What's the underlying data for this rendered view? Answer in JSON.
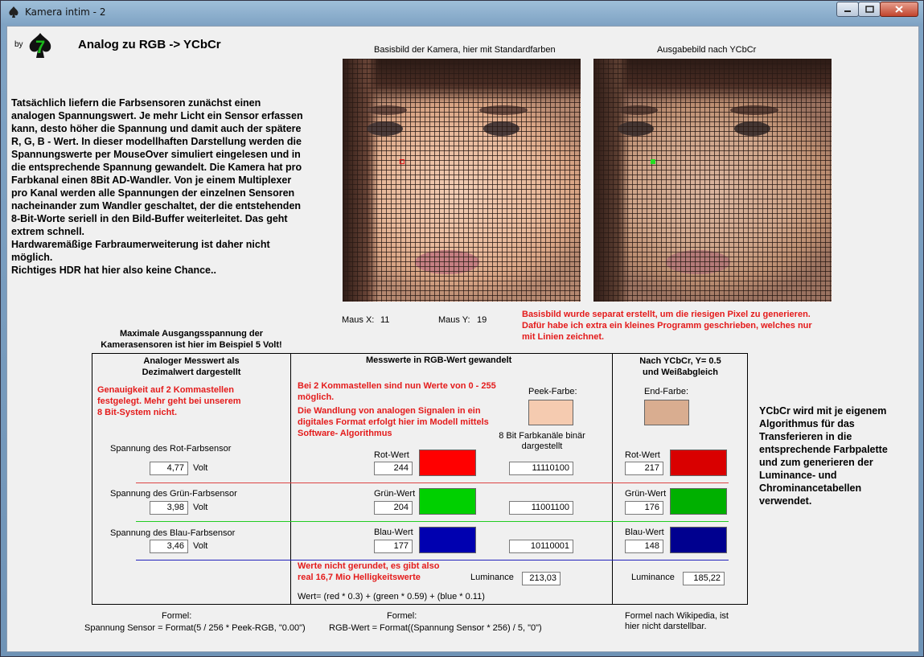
{
  "window": {
    "title": "Kamera intim - 2"
  },
  "header": {
    "by_label": "by",
    "title": "Analog zu RGB -> YCbCr"
  },
  "intro_lines": [
    "Tatsächlich liefern die Farbsensoren zunächst einen",
    "analogen Spannungswert. Je mehr Licht ein Sensor erfassen",
    "kann, desto höher die Spannung und damit auch der spätere",
    "R, G, B - Wert. In dieser modellhaften Darstellung werden die",
    "Spannungswerte per MouseOver simuliert eingelesen und in",
    "die entsprechende Spannung gewandelt. Die Kamera hat pro",
    "Farbkanal einen 8Bit AD-Wandler. Von je einem Multiplexer",
    "pro Kanal werden alle Spannungen der einzelnen Sensoren",
    "nacheinander zum Wandler geschaltet, der die entstehenden",
    "8-Bit-Worte seriell in den Bild-Buffer weiterleitet. Das geht",
    "extrem schnell.",
    "Hardwaremäßige Farbraumerweiterung ist daher nicht",
    "möglich.",
    "Richtiges HDR hat hier also keine Chance.."
  ],
  "images": {
    "left_caption": "Basisbild der Kamera, hier mit Standardfarben",
    "right_caption": "Ausgabebild nach YCbCr",
    "cursor_left_color": "#e41b1b",
    "cursor_right_color": "#22dd22"
  },
  "mouse": {
    "x_label": "Maus X:",
    "x_value": "11",
    "y_label": "Maus Y:",
    "y_value": "19"
  },
  "note_pixels": [
    "Basisbild wurde separat erstellt, um die riesigen Pixel zu generieren.",
    "Dafür habe ich extra ein kleines Programm geschrieben, welches nur",
    "mit Linien zeichnet."
  ],
  "max_voltage": [
    "Maximale Ausgangsspannung der",
    "Kamerasensoren ist hier im Beispiel 5 Volt!"
  ],
  "col1": {
    "header": [
      "Analoger Messwert als",
      "Dezimalwert dargestellt"
    ],
    "note": [
      "Genauigkeit auf 2 Kommastellen",
      "festgelegt. Mehr geht bei unserem",
      "8 Bit-System nicht."
    ],
    "red_label": "Spannung des Rot-Farbsensor",
    "red_value": "4,77",
    "green_label": "Spannung des Grün-Farbsensor",
    "green_value": "3,98",
    "blue_label": "Spannung des Blau-Farbsensor",
    "blue_value": "3,46",
    "unit": "Volt"
  },
  "col2": {
    "header": "Messwerte in RGB-Wert gewandelt",
    "note1": [
      "Bei 2 Kommastellen sind nun Werte von 0 - 255",
      "möglich."
    ],
    "note2": [
      "Die Wandlung von analogen Signalen in ein",
      "digitales Format erfolgt hier im Modell  mittels",
      "Software- Algorithmus"
    ],
    "peek_label": "Peek-Farbe:",
    "peek_color": "#f5cbb0",
    "binary_header": [
      "8 Bit Farbkanäle binär",
      "dargestellt"
    ],
    "red_label": "Rot-Wert",
    "red_value": "244",
    "red_binary": "11110100",
    "green_label": "Grün-Wert",
    "green_value": "204",
    "green_binary": "11001100",
    "blue_label": "Blau-Wert",
    "blue_value": "177",
    "blue_binary": "10110001",
    "note3": [
      "Werte nicht gerundet, es gibt also",
      "real 16,7 Mio Helligkeitswerte"
    ],
    "luminance_label": "Luminance",
    "luminance_value": "213,03",
    "formula": "Wert= (red * 0.3) + (green * 0.59) + (blue * 0.11)"
  },
  "col3": {
    "header": [
      "Nach YCbCr, Y= 0.5",
      "und Weißabgleich"
    ],
    "end_label": "End-Farbe:",
    "end_color": "#d9ad90",
    "red_label": "Rot-Wert",
    "red_value": "217",
    "green_label": "Grün-Wert",
    "green_value": "176",
    "blue_label": "Blau-Wert",
    "blue_value": "148",
    "luminance_label": "Luminance",
    "luminance_value": "185,22"
  },
  "swatch_colors": {
    "rgb_red": "#ff0000",
    "rgb_green": "#00d000",
    "rgb_blue": "#0000b0",
    "ycc_red": "#d90000",
    "ycc_green": "#00b000",
    "ycc_blue": "#00008f"
  },
  "right_note": [
    "YCbCr wird mit je eigenem",
    "Algorithmus für das",
    "Transferieren in die",
    "entsprechende Farbpalette",
    "und zum generieren der",
    "Luminance- und",
    "Chrominancetabellen",
    "verwendet."
  ],
  "formulas": {
    "f1_title": "Formel:",
    "f1_text": "Spannung Sensor = Format(5 / 256 * Peek-RGB, \"0.00\")",
    "f2_title": "Formel:",
    "f2_text": "RGB-Wert = Format((Spannung Sensor * 256) / 5, \"0\")",
    "f3_text": [
      "Formel nach Wikipedia, ist",
      "hier nicht darstellbar."
    ]
  }
}
